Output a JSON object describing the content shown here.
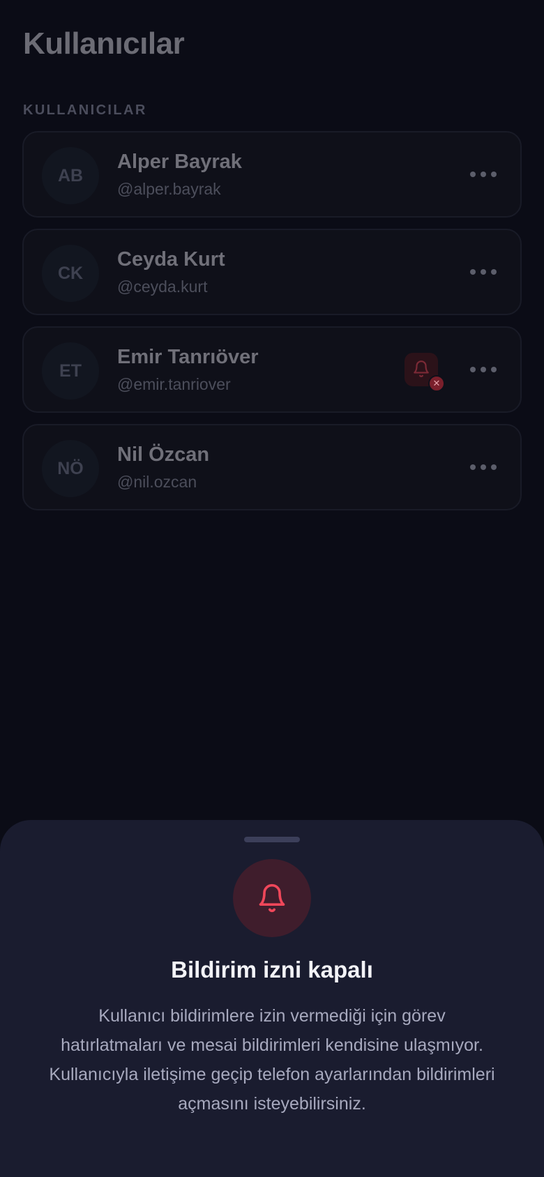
{
  "page": {
    "title": "Kullanıcılar",
    "section_label": "KULLANICILAR"
  },
  "users": [
    {
      "initials": "AB",
      "name": "Alper Bayrak",
      "handle": "@alper.bayrak",
      "notifications_disabled": false
    },
    {
      "initials": "CK",
      "name": "Ceyda Kurt",
      "handle": "@ceyda.kurt",
      "notifications_disabled": false
    },
    {
      "initials": "ET",
      "name": "Emir Tanrıöver",
      "handle": "@emir.tanriover",
      "notifications_disabled": true
    },
    {
      "initials": "NÖ",
      "name": "Nil Özcan",
      "handle": "@nil.ozcan",
      "notifications_disabled": false
    }
  ],
  "icons": {
    "more": "more-horizontal-icon",
    "notifications_off": "bell-off-icon",
    "sheet": "bell-icon"
  },
  "sheet": {
    "title": "Bildirim izni kapalı",
    "body": "Kullanıcı bildirimlere izin vermediği için görev hatırlatmaları ve mesai bildirimleri kendisine ulaşmıyor. Kullanıcıyla iletişime geçip telefon ayarlarından bildirimleri açmasını isteyebilirsiniz."
  },
  "colors": {
    "background": "#0b0c16",
    "sheet_background": "#1a1c2f",
    "danger": "#f0475a"
  }
}
